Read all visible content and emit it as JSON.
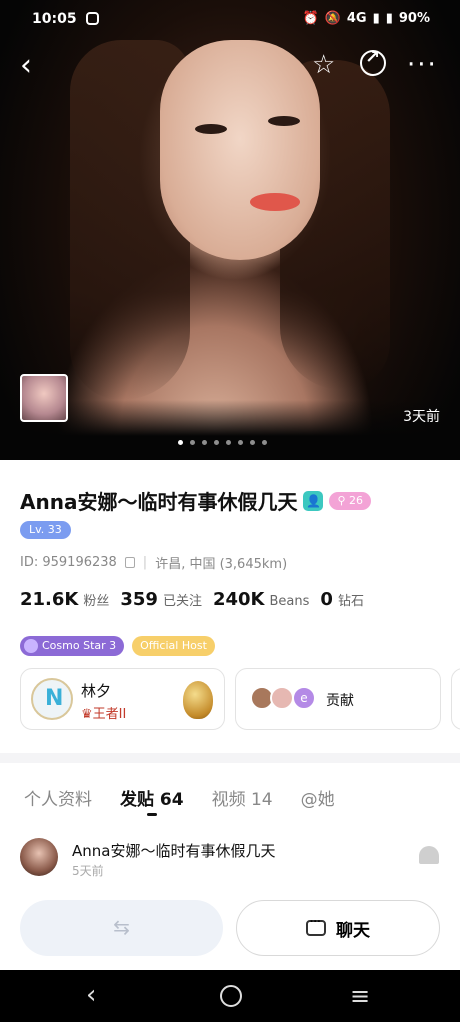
{
  "status": {
    "time": "10:05",
    "network": "4G",
    "battery": "90%"
  },
  "header": {
    "back_icon": "chevron-left-icon",
    "favorite_icon": "star-plus-icon",
    "share_icon": "share-icon",
    "more_icon": "more-icon"
  },
  "hero": {
    "time_ago": "3天前",
    "photo_count": 8,
    "active_index": 0
  },
  "profile": {
    "name": "Anna安娜～临时有事休假几天",
    "fan_badge": "26",
    "level": "Lv. 33",
    "id": "ID: 959196238",
    "location": "许昌, 中国 (3,645km)",
    "stats": [
      {
        "value": "21.6K",
        "label": "粉丝"
      },
      {
        "value": "359",
        "label": "已关注"
      },
      {
        "value": "240K",
        "label": "Beans"
      },
      {
        "value": "0",
        "label": "钻石"
      }
    ],
    "tags": [
      "Cosmo Star 3",
      "Official Host"
    ]
  },
  "cards": {
    "guardian_name": "林夕",
    "guardian_rank": "王者II",
    "contrib_label": "贡献",
    "contrib_avatar3": "e"
  },
  "tabs": [
    {
      "label": "个人资料"
    },
    {
      "label": "发贴 64"
    },
    {
      "label": "视频 14"
    },
    {
      "label": "@她"
    }
  ],
  "post": {
    "name": "Anna安娜～临时有事休假几天",
    "time": "5天前"
  },
  "actions": {
    "switch_symbol": "⇆",
    "chat_label": "聊天"
  }
}
